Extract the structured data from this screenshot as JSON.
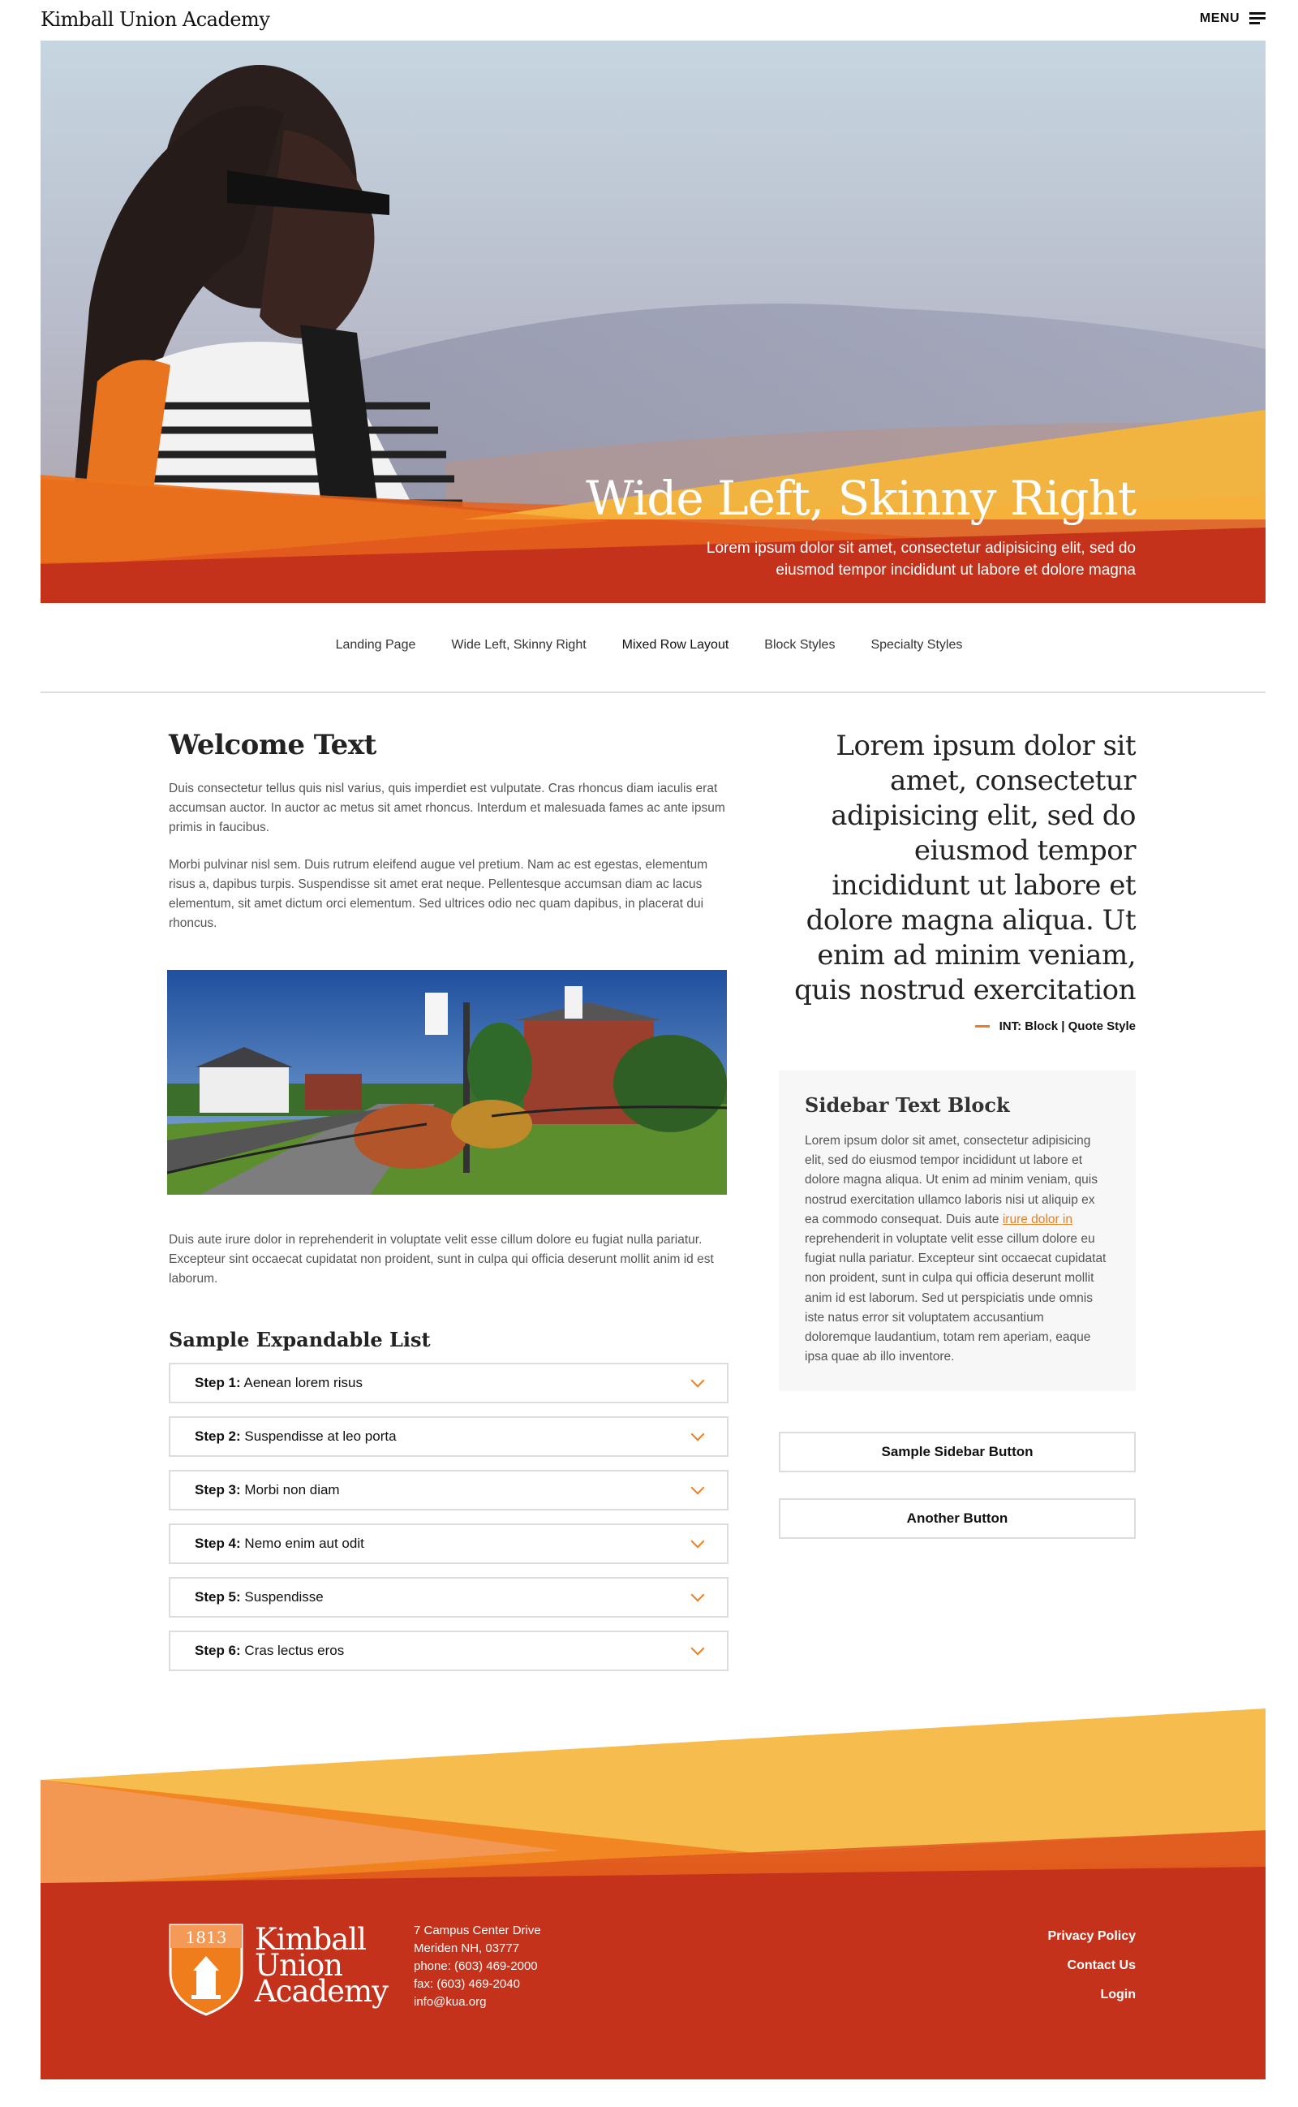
{
  "header": {
    "logo": "Kimball Union Academy",
    "menu_label": "MENU"
  },
  "hero": {
    "title": "Wide Left, Skinny Right",
    "subtitle": "Lorem ipsum dolor sit amet, consectetur adipisicing elit, sed do eiusmod tempor incididunt ut labore et dolore magna"
  },
  "tabs": [
    {
      "label": "Landing Page"
    },
    {
      "label": "Wide Left, Skinny Right"
    },
    {
      "label": "Mixed Row Layout"
    },
    {
      "label": "Block Styles"
    },
    {
      "label": "Specialty Styles"
    }
  ],
  "main": {
    "title": "Welcome Text",
    "para1": "Duis consectetur tellus quis nisl varius, quis imperdiet est vulputate. Cras rhoncus diam iaculis erat accumsan auctor. In auctor ac metus sit amet rhoncus. Interdum et malesuada fames ac ante ipsum primis in faucibus.",
    "para2": "Morbi pulvinar nisl sem. Duis rutrum eleifend augue vel pretium. Nam ac est egestas, elementum risus a, dapibus turpis. Suspendisse sit amet erat neque. Pellentesque accumsan diam ac lacus elementum, sit amet dictum orci elementum. Sed ultrices odio nec quam dapibus, in placerat dui rhoncus.",
    "para3": "Duis aute irure dolor in reprehenderit in voluptate velit esse cillum dolore eu fugiat nulla pariatur. Excepteur sint occaecat cupidatat non proident, sunt in culpa qui officia deserunt mollit anim id est laborum.",
    "expandable_title": "Sample Expandable List",
    "steps": [
      {
        "prefix": "Step 1:",
        "text": "Aenean lorem risus"
      },
      {
        "prefix": "Step 2:",
        "text": "Suspendisse at leo porta"
      },
      {
        "prefix": "Step 3:",
        "text": "Morbi non diam"
      },
      {
        "prefix": "Step 4:",
        "text": "Nemo enim aut odit"
      },
      {
        "prefix": "Step 5:",
        "text": "Suspendisse"
      },
      {
        "prefix": "Step 6:",
        "text": "Cras lectus eros"
      }
    ]
  },
  "sidebar": {
    "quote": "Lorem ipsum dolor sit amet, consectetur adipisicing elit, sed do eiusmod tempor incididunt ut labore et dolore magna aliqua. Ut enim ad minim veniam, quis nostrud exercitation",
    "quote_attr": "INT: Block | Quote Style",
    "block_title": "Sidebar Text Block",
    "block_text_before": "Lorem ipsum dolor sit amet, consectetur adipisicing elit, sed do eiusmod tempor incididunt ut labore et dolore magna aliqua. Ut enim ad minim veniam, quis nostrud exercitation ullamco laboris nisi ut aliquip ex ea commodo consequat. Duis aute ",
    "block_link": "irure dolor in",
    "block_text_after": " reprehenderit in voluptate velit esse cillum dolore eu fugiat nulla pariatur. Excepteur sint occaecat cupidatat non proident, sunt in culpa qui officia deserunt mollit anim id est laborum. Sed ut perspiciatis unde omnis iste natus error sit voluptatem accusantium doloremque laudantium, totam rem aperiam, eaque ipsa quae ab illo inventore.",
    "button1": "Sample Sidebar Button",
    "button2": "Another Button"
  },
  "footer": {
    "crest_year": "1813",
    "wordmark_line1": "Kimball",
    "wordmark_line2": "Union",
    "wordmark_line3": "Academy",
    "address": [
      "7 Campus Center Drive",
      "Meriden NH, 03777",
      "phone: (603) 469-2000",
      "fax: (603) 469-2040",
      "info@kua.org"
    ],
    "links": [
      "Privacy Policy",
      "Contact Us",
      "Login"
    ]
  },
  "colors": {
    "accent_orange": "#f07d1c",
    "footer_red": "#c4321c",
    "yellow": "#f5b53b",
    "tab_highlight": "#f39a59"
  }
}
